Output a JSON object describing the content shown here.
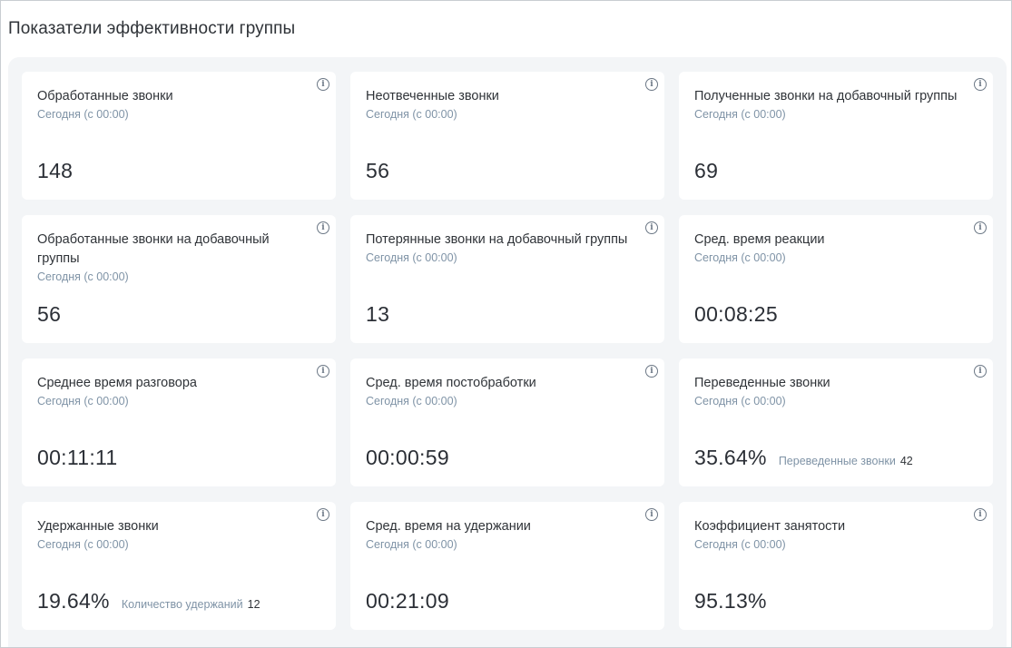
{
  "page": {
    "title": "Показатели эффективности группы"
  },
  "cards": [
    {
      "title": "Обработанные звонки",
      "subtitle": "Сегодня (с 00:00)",
      "value": "148"
    },
    {
      "title": "Неотвеченные звонки",
      "subtitle": "Сегодня (с 00:00)",
      "value": "56"
    },
    {
      "title": "Полученные звонки на добавочный группы",
      "subtitle": "Сегодня (с 00:00)",
      "value": "69"
    },
    {
      "title": "Обработанные звонки на добавочный группы",
      "subtitle": "Сегодня (с 00:00)",
      "value": "56"
    },
    {
      "title": "Потерянные звонки на добавочный группы",
      "subtitle": "Сегодня (с 00:00)",
      "value": "13"
    },
    {
      "title": "Сред. время реакции",
      "subtitle": "Сегодня (с 00:00)",
      "value": "00:08:25"
    },
    {
      "title": "Среднее время разговора",
      "subtitle": "Сегодня (с 00:00)",
      "value": "00:11:11"
    },
    {
      "title": "Сред. время постобработки",
      "subtitle": "Сегодня (с 00:00)",
      "value": "00:00:59"
    },
    {
      "title": "Переведенные звонки",
      "subtitle": "Сегодня (с 00:00)",
      "value": "35.64%",
      "extra_label": "Переведенные звонки",
      "extra_value": "42"
    },
    {
      "title": "Удержанные звонки",
      "subtitle": "Сегодня (с 00:00)",
      "value": "19.64%",
      "extra_label": "Количество удержаний",
      "extra_value": "12"
    },
    {
      "title": "Сред. время на удержании",
      "subtitle": "Сегодня (с 00:00)",
      "value": "00:21:09"
    },
    {
      "title": "Коэффициент занятости",
      "subtitle": "Сегодня (с 00:00)",
      "value": "95.13%"
    }
  ],
  "icons": {
    "info": "info-icon"
  },
  "colors": {
    "panel_bg": "#f3f5f7",
    "card_bg": "#ffffff",
    "subtitle": "#7f93a6",
    "text": "#2b2f36"
  }
}
